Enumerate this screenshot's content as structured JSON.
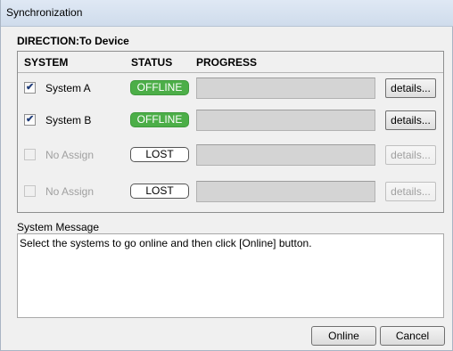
{
  "window": {
    "title": "Synchronization"
  },
  "direction": {
    "label": "DIRECTION:",
    "value": "To Device"
  },
  "table": {
    "headers": {
      "system": "SYSTEM",
      "status": "STATUS",
      "progress": "PROGRESS"
    },
    "rows": [
      {
        "checked": true,
        "enabled": true,
        "name": "System A",
        "status": "OFFLINE",
        "status_kind": "offline",
        "progress": 0,
        "details": "details..."
      },
      {
        "checked": true,
        "enabled": true,
        "name": "System B",
        "status": "OFFLINE",
        "status_kind": "offline",
        "progress": 0,
        "details": "details..."
      },
      {
        "checked": false,
        "enabled": false,
        "name": "No Assign",
        "status": "LOST",
        "status_kind": "lost",
        "progress": 0,
        "details": "details..."
      },
      {
        "checked": false,
        "enabled": false,
        "name": "No Assign",
        "status": "LOST",
        "status_kind": "lost",
        "progress": 0,
        "details": "details..."
      }
    ]
  },
  "message": {
    "label": "System Message",
    "text": "Select the systems to go online and then click [Online] button."
  },
  "buttons": {
    "online": "Online",
    "cancel": "Cancel"
  },
  "colors": {
    "offline_badge": "#4cae48",
    "title_bar": "#dfe8f4",
    "progress_track": "#d4d4d4"
  }
}
